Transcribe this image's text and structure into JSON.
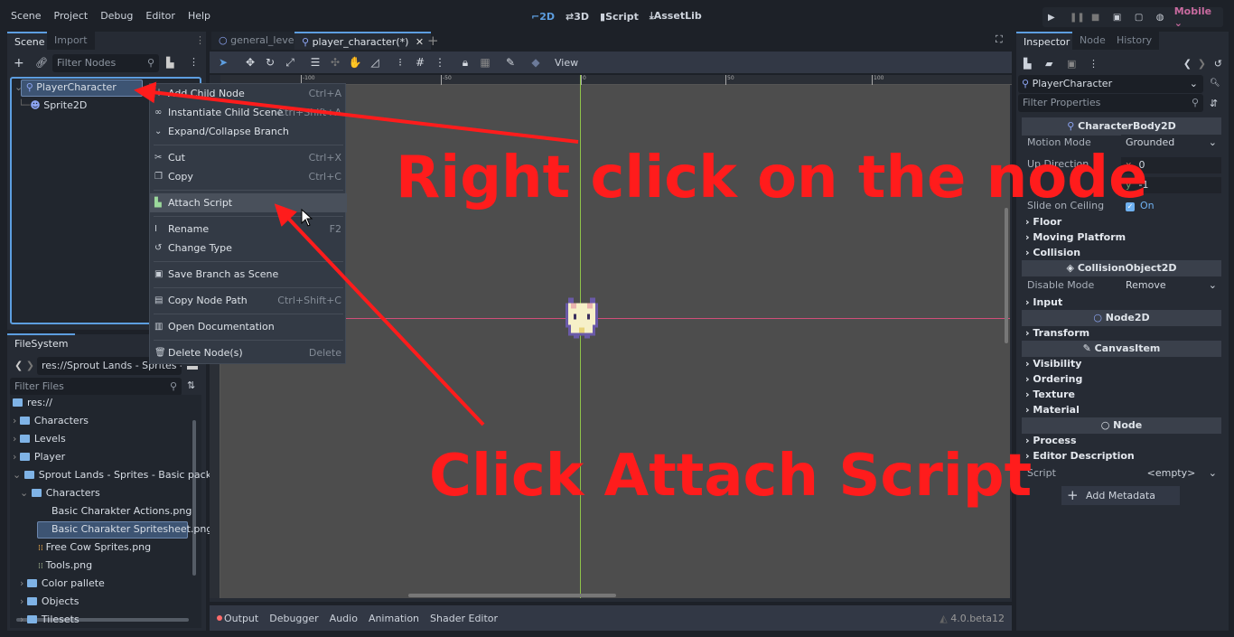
{
  "menubar": {
    "items": [
      "Scene",
      "Project",
      "Debug",
      "Editor",
      "Help"
    ]
  },
  "workspaces": [
    {
      "label": "2D",
      "icon": "2d-icon",
      "active": true
    },
    {
      "label": "3D",
      "icon": "3d-icon"
    },
    {
      "label": "Script",
      "icon": "script-icon"
    },
    {
      "label": "AssetLib",
      "icon": "download-icon"
    }
  ],
  "run_toolbar": {
    "renderer": "Mobile",
    "accent": "#c86a9f"
  },
  "scene_dock": {
    "tabs": [
      "Scene",
      "Import"
    ],
    "filter_placeholder": "Filter Nodes",
    "nodes": [
      {
        "name": "PlayerCharacter",
        "icon": "characterbody2d-icon",
        "selected": true
      },
      {
        "name": "Sprite2D",
        "icon": "sprite2d-icon"
      }
    ]
  },
  "filesystem": {
    "tab": "FileSystem",
    "path": "res://Sprout Lands - Sprites - Ba",
    "filter_placeholder": "Filter Files",
    "items": [
      {
        "label": "res://",
        "type": "folder"
      },
      {
        "label": "Characters",
        "type": "folder"
      },
      {
        "label": "Levels",
        "type": "folder"
      },
      {
        "label": "Player",
        "type": "folder"
      },
      {
        "label": "Sprout Lands - Sprites - Basic pack",
        "type": "folder",
        "expanded": true
      },
      {
        "label": "Characters",
        "type": "folder",
        "expanded": true
      },
      {
        "label": "Basic Charakter Actions.png",
        "type": "file"
      },
      {
        "label": "Basic Charakter Spritesheet.png",
        "type": "file",
        "selected": true
      },
      {
        "label": "Free Cow Sprites.png",
        "type": "file"
      },
      {
        "label": "Tools.png",
        "type": "file"
      },
      {
        "label": "Color pallete",
        "type": "folder"
      },
      {
        "label": "Objects",
        "type": "folder"
      },
      {
        "label": "Tilesets",
        "type": "folder"
      }
    ]
  },
  "editor_tabs": [
    {
      "label": "general_level",
      "icon": "node-icon"
    },
    {
      "label": "player_character(*)",
      "icon": "characterbody2d-icon",
      "active": true
    }
  ],
  "viewport_toolbar": {
    "view_label": "View"
  },
  "ruler": {
    "labels": [
      "-100",
      "-50",
      "0",
      "50",
      "100"
    ]
  },
  "context_menu": {
    "items": [
      {
        "label": "Add Child Node",
        "shortcut": "Ctrl+A",
        "icon": "plus-icon"
      },
      {
        "label": "Instantiate Child Scene",
        "shortcut": "Ctrl+Shift+A",
        "icon": "link-icon"
      },
      {
        "label": "Expand/Collapse Branch",
        "shortcut": "",
        "icon": "chevron-down-icon"
      },
      {
        "label": "Cut",
        "shortcut": "Ctrl+X",
        "icon": "scissors-icon"
      },
      {
        "label": "Copy",
        "shortcut": "Ctrl+C",
        "icon": "copy-icon"
      },
      {
        "label": "Attach Script",
        "shortcut": "",
        "icon": "attach-script-icon",
        "hovered": true
      },
      {
        "label": "Rename",
        "shortcut": "F2",
        "icon": "rename-icon"
      },
      {
        "label": "Change Type",
        "shortcut": "",
        "icon": "rotate-icon"
      },
      {
        "label": "Save Branch as Scene",
        "shortcut": "",
        "icon": "clapper-icon"
      },
      {
        "label": "Copy Node Path",
        "shortcut": "Ctrl+Shift+C",
        "icon": "node-path-icon"
      },
      {
        "label": "Open Documentation",
        "shortcut": "",
        "icon": "doc-icon"
      },
      {
        "label": "Delete Node(s)",
        "shortcut": "Delete",
        "icon": "trash-icon"
      }
    ]
  },
  "bottom_panel": {
    "tabs": [
      "Output",
      "Debugger",
      "Audio",
      "Animation",
      "Shader Editor"
    ],
    "version": "4.0.beta12"
  },
  "inspector": {
    "tabs": [
      "Inspector",
      "Node",
      "History"
    ],
    "node": "PlayerCharacter",
    "filter_placeholder": "Filter Properties",
    "sections": {
      "characterbody": "CharacterBody2D",
      "motion_mode_label": "Motion Mode",
      "motion_mode": "Grounded",
      "up_direction_label": "Up Direction",
      "up_x": "0",
      "up_y": "-1",
      "slide_label": "Slide on Ceiling",
      "slide_value": "On",
      "floor": "Floor",
      "moving_platform": "Moving Platform",
      "collision": "Collision",
      "collisionobject": "CollisionObject2D",
      "disable_mode_label": "Disable Mode",
      "disable_mode": "Remove",
      "input": "Input",
      "node2d": "Node2D",
      "transform": "Transform",
      "canvasitem": "CanvasItem",
      "visibility": "Visibility",
      "ordering": "Ordering",
      "texture": "Texture",
      "material": "Material",
      "node": "Node",
      "process": "Process",
      "editor_description": "Editor Description",
      "script_label": "Script",
      "script_value": "<empty>",
      "add_metadata": "Add Metadata"
    }
  },
  "annotations": {
    "top": "Right click on the node",
    "bottom": "Click Attach Script",
    "color": "#ff1c1c"
  }
}
